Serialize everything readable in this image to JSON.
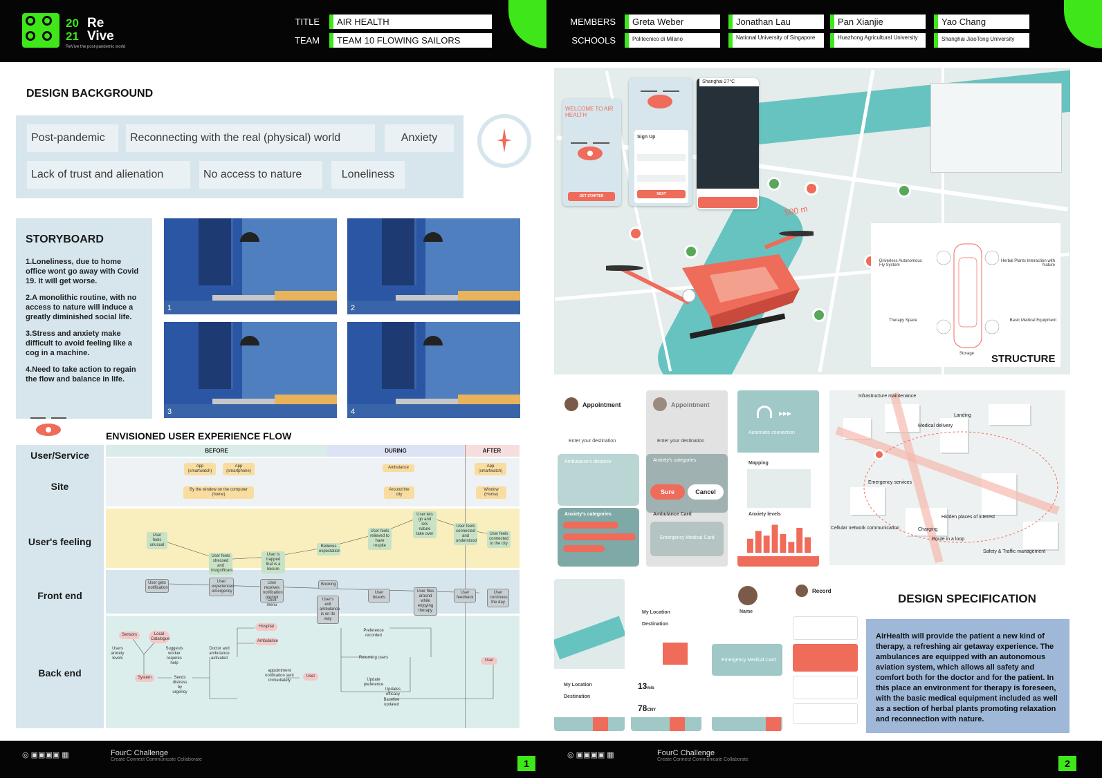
{
  "header": {
    "logo_year_top": "20",
    "logo_year_bottom": "21",
    "logo_word_top": "Re",
    "logo_word_bottom": "Vive",
    "logo_tagline": "ReVive the post-pandemic world",
    "title_label": "TITLE",
    "title_value": "AIR HEALTH",
    "team_label": "TEAM",
    "team_value": "TEAM 10 FLOWING SAILORS",
    "members_label": "MEMBERS",
    "schools_label": "SCHOOLS",
    "members": [
      "Greta Weber",
      "Jonathan Lau",
      "Pan Xianjie",
      "Yao Chang"
    ],
    "schools": [
      "Politecnico di Milano",
      "National University of Singapore",
      "Huazhong Agricultural University",
      "Shanghai JiaoTong University"
    ]
  },
  "background": {
    "title": "DESIGN BACKGROUND",
    "tags": [
      "Post-pandemic",
      "Reconnecting with the real (physical) world",
      "Anxiety",
      "Lack of trust and alienation",
      "No access to nature",
      "Loneliness"
    ]
  },
  "storyboard": {
    "title": "STORYBOARD",
    "items": [
      "1.Loneliness, due to home office wont go away with Covid 19. It will get worse.",
      "2.A monolithic routine, with no access to nature will induce a greatly diminished social life.",
      "3.Stress and anxiety make difficult to avoid feeling like a cog in a machine.",
      "4.Need to take action to regain the flow and balance in life."
    ],
    "panel_numbers": [
      "1",
      "2",
      "3",
      "4"
    ]
  },
  "ux_flow": {
    "title": "ENVISIONED USER EXPERIENCE FLOW",
    "phases": [
      "BEFORE",
      "DURING",
      "AFTER"
    ],
    "row_labels": [
      "User/Service",
      "Site",
      "User's feeling",
      "Front end",
      "Back end"
    ],
    "service_nodes": [
      "App (smartwatch)",
      "App (smartphone)",
      "Ambulance",
      "App (smartwatch)"
    ],
    "site_nodes": [
      "By the window on the computer (home)",
      "Around the city",
      "Window (Home)"
    ],
    "feeling_nodes": [
      "User feels unusual",
      "User feels stressed and insignificant",
      "User is trapped that is a leisure",
      "Relieves expectation",
      "User feels relieved to have respite",
      "User lets go and lets nature take over",
      "User feels connected and understood",
      "User feels connected to the city"
    ],
    "front_nodes": [
      "User gets notification",
      "User experiences emergency",
      "User receives notification prompt",
      "Booking",
      "User boards",
      "User flies around while enjoying therapy",
      "User feedback",
      "User continues the day",
      "Click menu",
      "User's exit ambulance is on its way"
    ],
    "back_nodes": [
      "Sensors",
      "Users anxiety levels",
      "Local Catalogue",
      "Suggests worker requires help",
      "System",
      "Sends distress by urgency",
      "Doctor and ambulance activated",
      "Hospital",
      "Ambulance",
      "appointment notification sent immediately",
      "User",
      "Preference recorded",
      "Returning users",
      "Update preference",
      "Updates efficacy",
      "User",
      "Baseline updated"
    ]
  },
  "map": {
    "welcome": "WELCOME TO AIR HEALTH",
    "get_started": "GET STARTED",
    "sign_up": "Sign Up",
    "next": "NEXT",
    "city": "Shanghai",
    "temp": "27°C",
    "distance": "500 m"
  },
  "structure": {
    "title": "STRUCTURE",
    "labels": [
      "Driverless Autonomous Fly System",
      "Herbal Plants Interaction with Nature",
      "Therapy Space",
      "Basic Medical Equipment",
      "Storage"
    ]
  },
  "app_screens": {
    "appointment_a": "Appointment",
    "appointment_b": "Appointment",
    "enter_destination": "Enter your destination",
    "ambulance_distance": "Ambulance's distance",
    "anxiety_categories": "Anxiety's categories",
    "sure": "Sure",
    "cancel": "Cancel",
    "ambulance_card": "Ambulance Card",
    "emergency_card": "Emergency Medical Card",
    "auto_connection": "Automatic connection",
    "mapping": "Mapping",
    "anxiety_levels": "Anxiety levels",
    "my_location": "My Location",
    "destination": "Destination",
    "my_location_2": "My Location",
    "destination_2": "Destination",
    "name": "Name",
    "record": "Record",
    "speed": "13",
    "speed_unit": "m/s",
    "price": "78",
    "price_unit": "CNY",
    "anxiety_bars": [
      0.45,
      0.7,
      0.55,
      0.9,
      0.6,
      0.35,
      0.8,
      0.5
    ]
  },
  "city_map": {
    "labels": [
      "Infrastructure maintenance",
      "Medical delivery",
      "Emergency services",
      "Hidden places of interest",
      "Cellular network communication",
      "Charging",
      "Route in a loop",
      "Safety & Traffic management",
      "Landing"
    ]
  },
  "spec": {
    "title": "DESIGN SPECIFICATION",
    "text": "AirHealth will provide the patient a new kind of therapy, a refreshing air getaway experience. The ambulances are equipped with an autonomous aviation system, which allows all safety and comfort both for the doctor and for the patient. In this place an environment for therapy is foreseen, with the basic medical equipment included as well as a section of herbal plants promoting relaxation and reconnection with nature."
  },
  "footer": {
    "challenge": "FourC  Challenge",
    "challenge_sub": "Create Connect Communicate Collaborate",
    "pages": [
      "1",
      "2"
    ]
  },
  "colors": {
    "accent_green": "#3ee61a",
    "panel_blue": "#d6e6ec",
    "coral": "#ef6b5a",
    "teal": "#67c3c0"
  }
}
